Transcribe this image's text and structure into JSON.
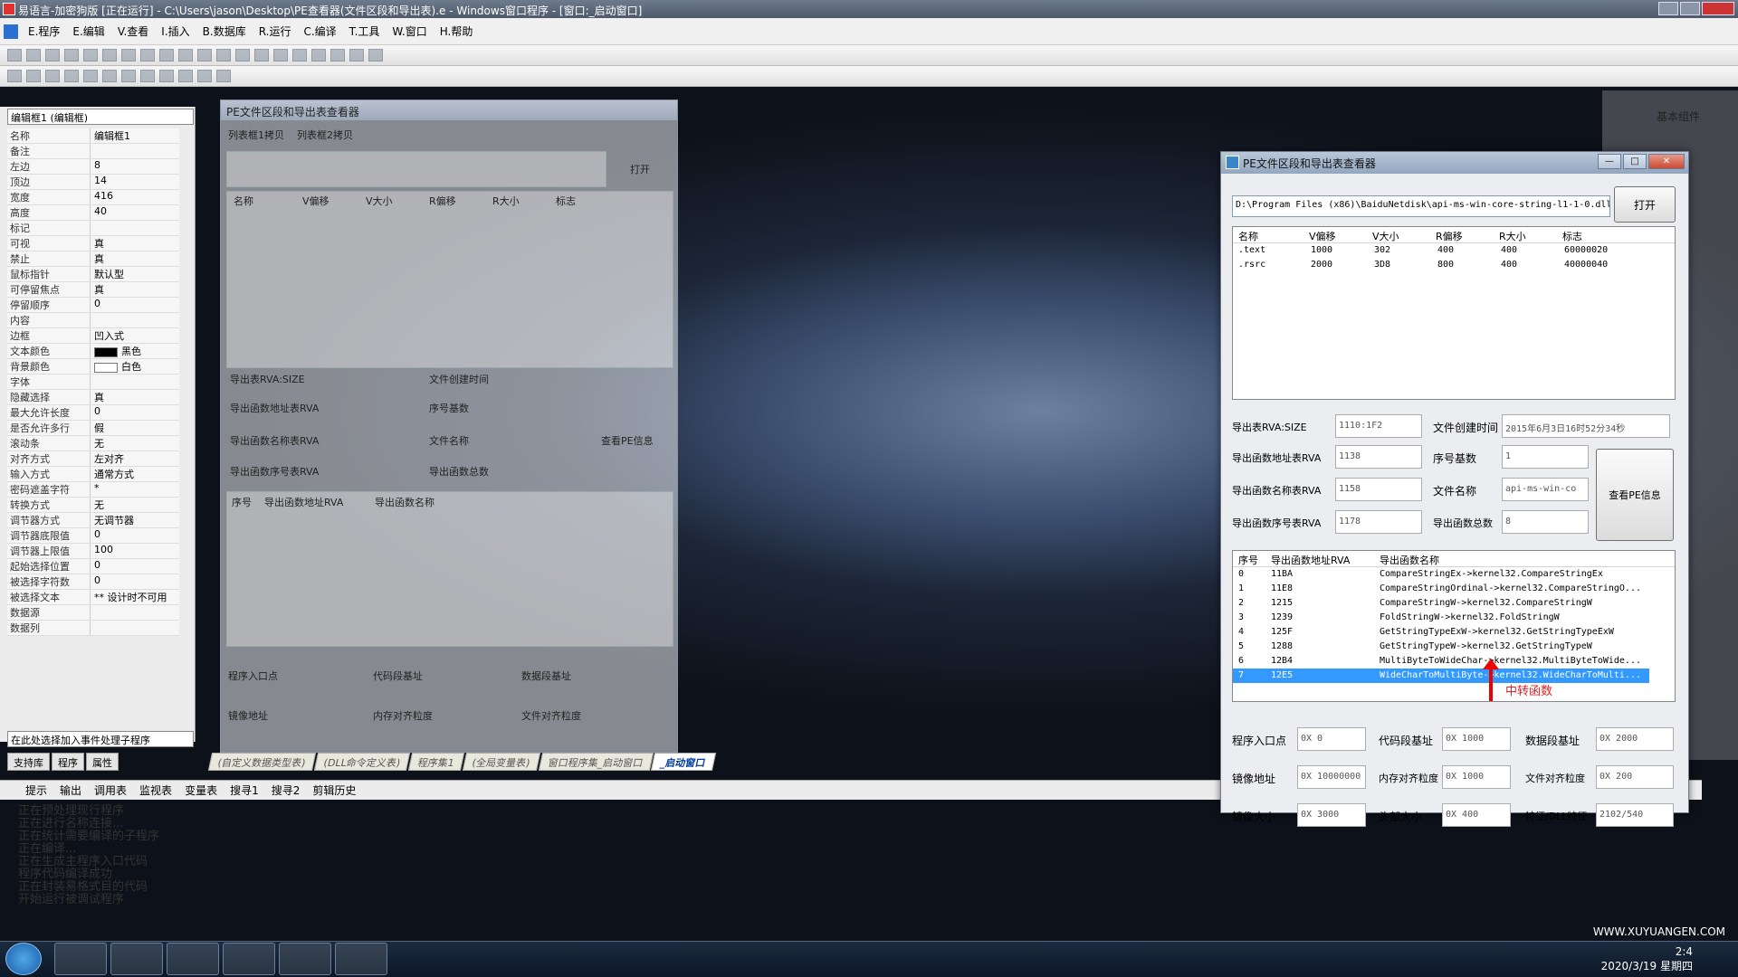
{
  "app": {
    "title": "易语言-加密狗版 [正在运行] - C:\\Users\\jason\\Desktop\\PE查看器(文件区段和导出表).e - Windows窗口程序 - [窗口:_启动窗口]"
  },
  "menu": [
    "E.程序",
    "E.编辑",
    "V.查看",
    "I.插入",
    "B.数据库",
    "R.运行",
    "C.编译",
    "T.工具",
    "W.窗口",
    "H.帮助"
  ],
  "properties": {
    "combo": "编辑框1 (编辑框)",
    "rows": [
      {
        "k": "名称",
        "v": "编辑框1"
      },
      {
        "k": "备注",
        "v": ""
      },
      {
        "k": "左边",
        "v": "8"
      },
      {
        "k": "顶边",
        "v": "14"
      },
      {
        "k": "宽度",
        "v": "416"
      },
      {
        "k": "高度",
        "v": "40"
      },
      {
        "k": "标记",
        "v": ""
      },
      {
        "k": "可视",
        "v": "真"
      },
      {
        "k": "禁止",
        "v": "真"
      },
      {
        "k": "鼠标指针",
        "v": "默认型"
      },
      {
        "k": "可停留焦点",
        "v": "真"
      },
      {
        "k": "停留顺序",
        "v": "0"
      },
      {
        "k": "内容",
        "v": ""
      },
      {
        "k": "边框",
        "v": "凹入式"
      },
      {
        "k": "文本颜色",
        "v": "黑色"
      },
      {
        "k": "背景颜色",
        "v": "白色"
      },
      {
        "k": "字体",
        "v": ""
      },
      {
        "k": "隐藏选择",
        "v": "真"
      },
      {
        "k": "最大允许长度",
        "v": "0"
      },
      {
        "k": "是否允许多行",
        "v": "假"
      },
      {
        "k": "滚动条",
        "v": "无"
      },
      {
        "k": "对齐方式",
        "v": "左对齐"
      },
      {
        "k": "输入方式",
        "v": "通常方式"
      },
      {
        "k": "密码遮盖字符",
        "v": "*"
      },
      {
        "k": "转换方式",
        "v": "无"
      },
      {
        "k": "调节器方式",
        "v": "无调节器"
      },
      {
        "k": "调节器底限值",
        "v": "0"
      },
      {
        "k": "调节器上限值",
        "v": "100"
      },
      {
        "k": "起始选择位置",
        "v": "0"
      },
      {
        "k": "被选择字符数",
        "v": "0"
      },
      {
        "k": "被选择文本",
        "v": "** 设计时不可用"
      },
      {
        "k": "数据源",
        "v": ""
      },
      {
        "k": "数据列",
        "v": ""
      }
    ],
    "event_combo": "在此处选择加入事件处理子程序"
  },
  "panel_tabs": [
    "支持库",
    "程序",
    "属性"
  ],
  "doc_tabs": [
    "(自定义数据类型表)",
    "(DLL命令定义表)",
    "程序集1",
    "(全局变量表)",
    "窗口程序集_启动窗口",
    "_启动窗口"
  ],
  "output_tabs": [
    "提示",
    "输出",
    "调用表",
    "监视表",
    "变量表",
    "搜寻1",
    "搜寻2",
    "剪辑历史"
  ],
  "output_lines": "正在预处理现行程序\n正在进行名称连接...\n正在统计需要编译的子程序\n正在编译...\n正在生成主程序入口代码\n程序代码编译成功\n正在封装易格式目的代码\n开始运行被调试程序",
  "designer": {
    "title": "PE文件区段和导出表查看器",
    "tab1": "列表框1拷贝",
    "tab2": "列表框2拷贝",
    "open": "打开",
    "headers": [
      "名称",
      "V偏移",
      "V大小",
      "R偏移",
      "R大小",
      "标志"
    ],
    "labels": [
      "导出表RVA:SIZE",
      "导出函数地址表RVA",
      "导出函数名称表RVA",
      "导出函数序号表RVA",
      "文件创建时间",
      "序号基数",
      "文件名称",
      "导出函数总数",
      "查看PE信息"
    ],
    "list2_headers": [
      "序号",
      "导出函数地址RVA",
      "导出函数名称"
    ],
    "bottom_labels": [
      "程序入口点",
      "代码段基址",
      "数据段基址",
      "镜像地址",
      "内存对齐粒度",
      "文件对齐粒度",
      "镜像大小",
      "头部大小",
      "特征/DLL特征"
    ]
  },
  "viewer": {
    "title": "PE文件区段和导出表查看器",
    "path": "D:\\Program Files (x86)\\BaiduNetdisk\\api-ms-win-core-string-l1-1-0.dll",
    "open_button": "打开",
    "section_headers": [
      "名称",
      "V偏移",
      "V大小",
      "R偏移",
      "R大小",
      "标志"
    ],
    "sections": [
      [
        ".text",
        "1000",
        "302",
        "400",
        "400",
        "60000020"
      ],
      [
        ".rsrc",
        "2000",
        "3D8",
        "800",
        "400",
        "40000040"
      ]
    ],
    "export_rva_label": "导出表RVA:SIZE",
    "export_rva": "1110:1F2",
    "func_addr_label": "导出函数地址表RVA",
    "func_addr": "1138",
    "func_name_label": "导出函数名称表RVA",
    "func_name": "1158",
    "func_ord_label": "导出函数序号表RVA",
    "func_ord": "1178",
    "created_label": "文件创建时间",
    "created": "2015年6月3日16时52分34秒",
    "base_label": "序号基数",
    "base": "1",
    "filename_label": "文件名称",
    "filename": "api-ms-win-co",
    "total_label": "导出函数总数",
    "total": "8",
    "view_button": "查看PE信息",
    "export_headers": [
      "序号",
      "导出函数地址RVA",
      "导出函数名称"
    ],
    "exports": [
      [
        "0",
        "11BA",
        "CompareStringEx->kernel32.CompareStringEx"
      ],
      [
        "1",
        "11E8",
        "CompareStringOrdinal->kernel32.CompareStringO..."
      ],
      [
        "2",
        "1215",
        "CompareStringW->kernel32.CompareStringW"
      ],
      [
        "3",
        "1239",
        "FoldStringW->kernel32.FoldStringW"
      ],
      [
        "4",
        "125F",
        "GetStringTypeExW->kernel32.GetStringTypeExW"
      ],
      [
        "5",
        "1288",
        "GetStringTypeW->kernel32.GetStringTypeW"
      ],
      [
        "6",
        "12B4",
        "MultiByteToWideChar->kernel32.MultiByteToWide..."
      ],
      [
        "7",
        "12E5",
        "WideCharToMultiByte->kernel32.WideCharToMulti..."
      ]
    ],
    "selected_index": 7,
    "entry_label": "程序入口点",
    "entry": "0X 0",
    "code_label": "代码段基址",
    "code": "0X 1000",
    "data_label": "数据段基址",
    "data": "0X 2000",
    "image_label": "镜像地址",
    "image": "0X 10000000",
    "memalign_label": "内存对齐粒度",
    "memalign": "0X 1000",
    "filealign_label": "文件对齐粒度",
    "filealign": "0X 200",
    "size_label": "镜像大小",
    "size": "0X 3000",
    "header_label": "头部大小",
    "header": "0X 400",
    "chars_label": "特征/DLL特征",
    "chars": "2102/540"
  },
  "annotation": "中转函数",
  "right_panel_title": "基本组件",
  "clock": {
    "time": "2:4",
    "date": "2020/3/19 星期四"
  },
  "watermark": "WWW.XUYUANGEN.COM"
}
